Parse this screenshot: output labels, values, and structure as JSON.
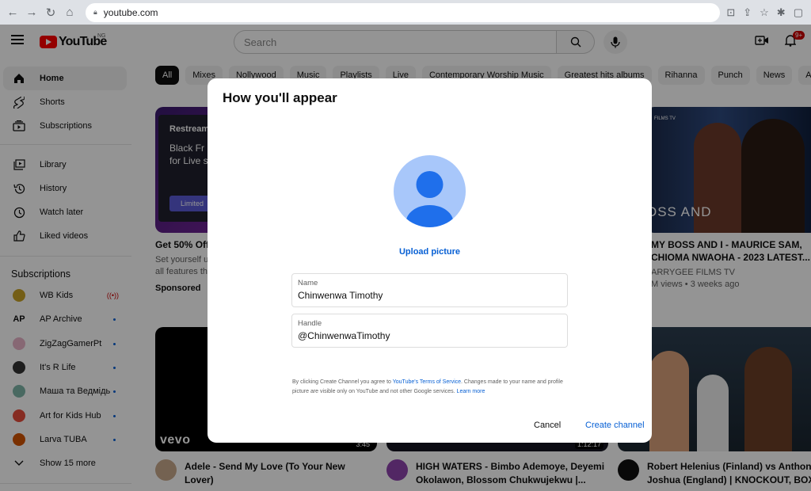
{
  "browser": {
    "url": "youtube.com"
  },
  "youtube": {
    "logo_text": "YouTube",
    "country_code": "NG",
    "search_placeholder": "Search",
    "notification_count": "9+"
  },
  "sidebar": {
    "main": [
      {
        "label": "Home",
        "icon": "home-icon",
        "active": true
      },
      {
        "label": "Shorts",
        "icon": "shorts-icon"
      },
      {
        "label": "Subscriptions",
        "icon": "subscriptions-icon"
      }
    ],
    "library": [
      {
        "label": "Library",
        "icon": "library-icon"
      },
      {
        "label": "History",
        "icon": "history-icon"
      },
      {
        "label": "Watch later",
        "icon": "watch-later-icon"
      },
      {
        "label": "Liked videos",
        "icon": "liked-videos-icon"
      }
    ],
    "subscriptions_title": "Subscriptions",
    "subscriptions": [
      {
        "label": "WB Kids",
        "live": true
      },
      {
        "label": "AP Archive"
      },
      {
        "label": "ZigZagGamerPt"
      },
      {
        "label": "It's R Life"
      },
      {
        "label": "Маша та Ведмідь"
      },
      {
        "label": "Art for Kids Hub"
      },
      {
        "label": "Larva TUBA"
      }
    ],
    "show_more": "Show 15 more"
  },
  "chips": [
    "All",
    "Mixes",
    "Nollywood",
    "Music",
    "Playlists",
    "Live",
    "Contemporary Worship Music",
    "Greatest hits albums",
    "Rihanna",
    "Punch",
    "News",
    "A"
  ],
  "videos": {
    "ad": {
      "title": "Get 50% Off",
      "desc1": "Set yourself up",
      "desc2": "all features the",
      "sponsored": "Sponsored",
      "thumb_line1": "Restream",
      "thumb_line2": "Black Fr",
      "thumb_line3": "for Live s",
      "thumb_btn": "Limited"
    },
    "boss": {
      "title1": "MY BOSS AND I - MAURICE SAM,",
      "title2": "CHIOMA NWAOHA - 2023 LATEST...",
      "channel": "ARRYGEE FILMS TV",
      "meta": "M views • 3 weeks ago",
      "brand": "FILMS TV",
      "overlay": "OSS AND"
    },
    "adele": {
      "title1": "Adele - Send My Love (To Your New",
      "title2": "Lover)",
      "duration": "3:45",
      "logo": "vevo"
    },
    "high": {
      "title1": "HIGH WATERS - Bimbo Ademoye, Deyemi",
      "title2": "Okolawon, Blossom Chukwujekwu |...",
      "duration": "1:12:17"
    },
    "boxing": {
      "title1": "Robert Helenius (Finland) vs Anthony",
      "title2": "Joshua (England) | KNOCKOUT, BOXIN"
    }
  },
  "dialog": {
    "title": "How you'll appear",
    "upload_label": "Upload picture",
    "name_label": "Name",
    "name_value": "Chinwenwa Timothy",
    "handle_label": "Handle",
    "handle_value": "@ChinwenwaTimothy",
    "terms_prefix": "By clicking Create Channel you agree to ",
    "terms_link": "YouTube's Terms of Service",
    "terms_mid": ". Changes made to your name and profile picture are visible only on YouTube and not other Google services. ",
    "learn_more": "Learn more",
    "cancel": "Cancel",
    "create": "Create channel"
  },
  "colors": {
    "accent": "#065fd4",
    "brand_red": "#ff0000",
    "avatar_bg": "#a8c7fa",
    "avatar_fg": "#1f6feb"
  }
}
